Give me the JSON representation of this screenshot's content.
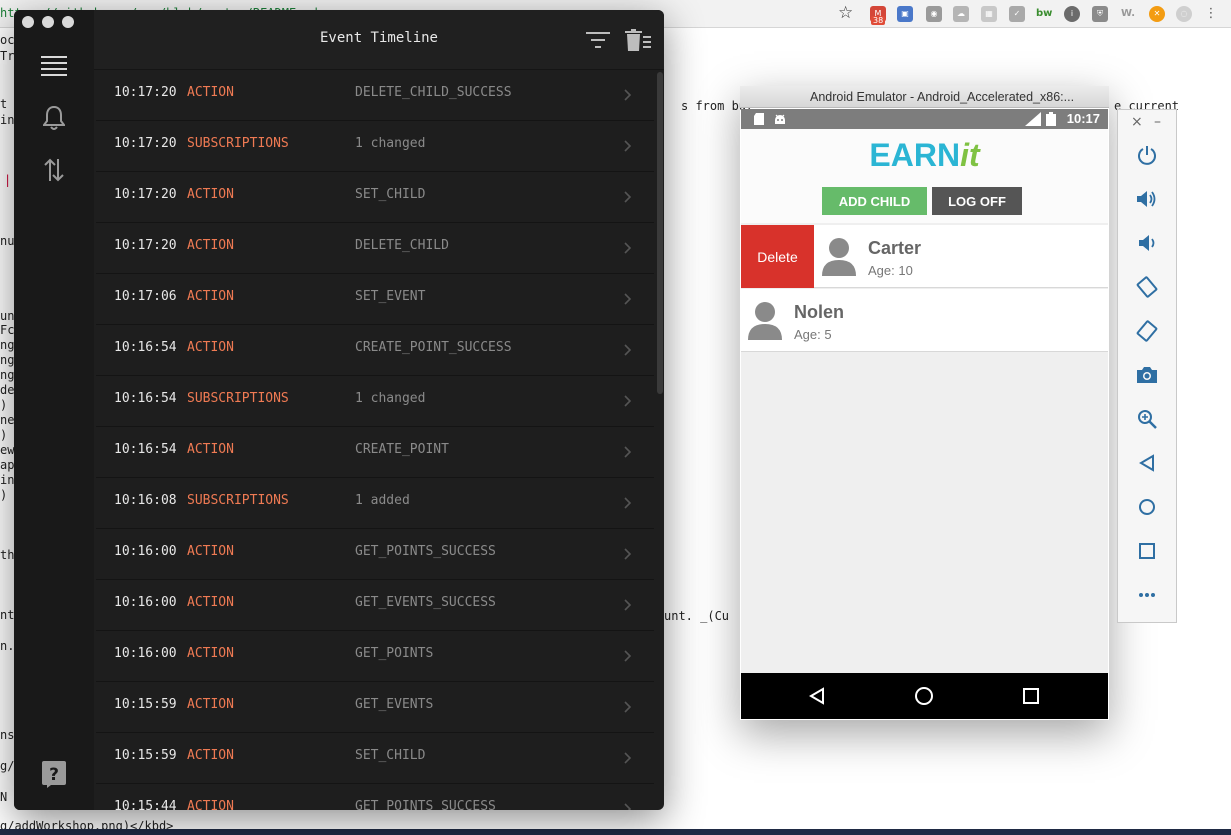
{
  "browser": {
    "url_text": "https://github.com/.../blob/master/README.md",
    "extension_badge": "38",
    "ext_labels": {
      "bw": "bw",
      "w": "W."
    }
  },
  "background_doc": {
    "lines": [
      "ock",
      "Tr",
      "t",
      "in",
      "|",
      "nu",
      "unt",
      "Fcr",
      "ng-",
      "ng",
      "ng",
      "de",
      ")",
      "ne",
      ")",
      "ew-",
      "ap",
      "in",
      ")",
      "th",
      "nt",
      "n.",
      "ns",
      "g/",
      "N"
    ],
    "from_but_text": "s from but",
    "current_text": "e current",
    "count_text": "unt.  _(Cu",
    "bottom_text": "g/addWorkshop.png)</kbd>"
  },
  "reactotron": {
    "title": "Event Timeline",
    "events": [
      {
        "time": "10:17:20",
        "type": "ACTION",
        "name": "DELETE_CHILD_SUCCESS"
      },
      {
        "time": "10:17:20",
        "type": "SUBSCRIPTIONS",
        "name": "1 changed"
      },
      {
        "time": "10:17:20",
        "type": "ACTION",
        "name": "SET_CHILD"
      },
      {
        "time": "10:17:20",
        "type": "ACTION",
        "name": "DELETE_CHILD"
      },
      {
        "time": "10:17:06",
        "type": "ACTION",
        "name": "SET_EVENT"
      },
      {
        "time": "10:16:54",
        "type": "ACTION",
        "name": "CREATE_POINT_SUCCESS"
      },
      {
        "time": "10:16:54",
        "type": "SUBSCRIPTIONS",
        "name": "1 changed"
      },
      {
        "time": "10:16:54",
        "type": "ACTION",
        "name": "CREATE_POINT"
      },
      {
        "time": "10:16:08",
        "type": "SUBSCRIPTIONS",
        "name": "1 added"
      },
      {
        "time": "10:16:00",
        "type": "ACTION",
        "name": "GET_POINTS_SUCCESS"
      },
      {
        "time": "10:16:00",
        "type": "ACTION",
        "name": "GET_EVENTS_SUCCESS"
      },
      {
        "time": "10:16:00",
        "type": "ACTION",
        "name": "GET_POINTS"
      },
      {
        "time": "10:15:59",
        "type": "ACTION",
        "name": "GET_EVENTS"
      },
      {
        "time": "10:15:59",
        "type": "ACTION",
        "name": "SET_CHILD"
      },
      {
        "time": "10:15:44",
        "type": "ACTION",
        "name": "GET_POINTS_SUCCESS"
      }
    ],
    "colors": {
      "accent": "#ef7a53",
      "text": "#e8e8e8",
      "muted": "#8a8a8a",
      "bg": "#1e1e1e"
    }
  },
  "emulator": {
    "window_title": "Android Emulator - Android_Accelerated_x86:...",
    "status_clock": "10:17",
    "logo_earn": "EARN",
    "logo_it": "it",
    "add_child_label": "ADD CHILD",
    "log_off_label": "LOG OFF",
    "delete_label": "Delete",
    "children": [
      {
        "name": "Carter",
        "age": "Age: 10"
      },
      {
        "name": "Nolen",
        "age": "Age: 5"
      }
    ],
    "colors": {
      "add_child": "#66bb6a",
      "log_off": "#555555",
      "delete": "#d8322b",
      "logo_earn": "#2bb5d4",
      "logo_it": "#7fc243"
    }
  }
}
